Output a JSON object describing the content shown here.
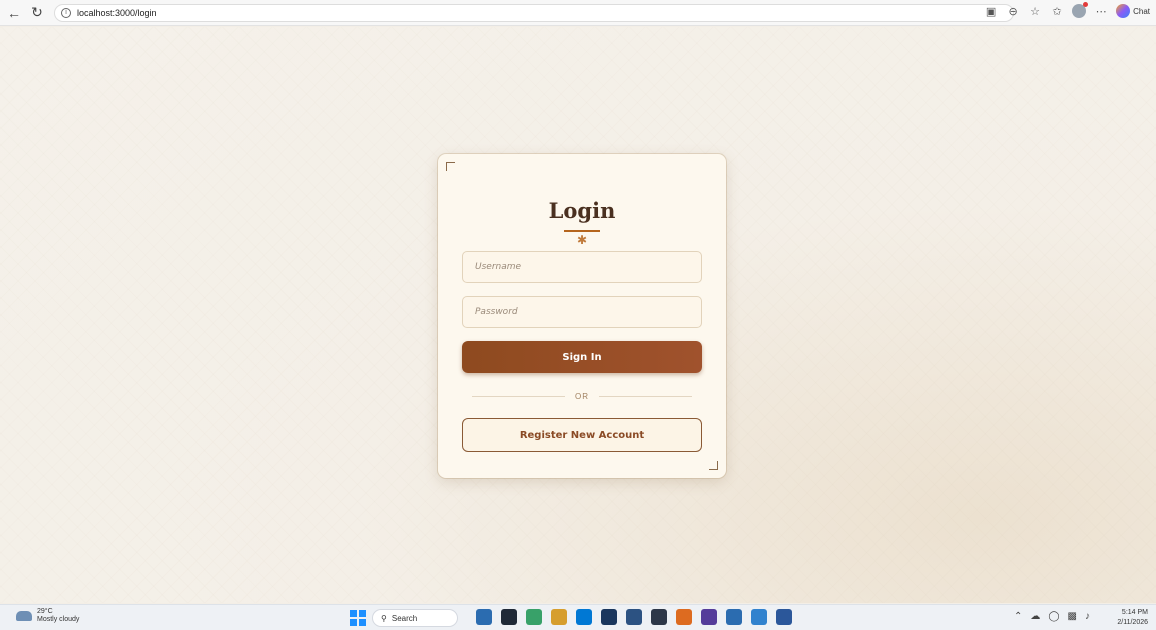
{
  "browser": {
    "url": "localhost:3000/login",
    "chat_label": "Chat"
  },
  "login": {
    "title": "Login",
    "ornament": "✱",
    "username_placeholder": "Username",
    "password_placeholder": "Password",
    "signin_label": "Sign In",
    "or_label": "OR",
    "register_label": "Register New Account"
  },
  "taskbar": {
    "weather_temp": "29°C",
    "weather_desc": "Mostly cloudy",
    "search_label": "Search",
    "time": "5:14 PM",
    "date": "2/11/2026",
    "app_colors": [
      "#2b6cb0",
      "#1f2937",
      "#38a169",
      "#d69e2e",
      "#0078d4",
      "#1a365d",
      "#2c5282",
      "#2d3748",
      "#dd6b20",
      "#553c9a",
      "#2b6cb0",
      "#3182ce",
      "#2b579a"
    ]
  }
}
